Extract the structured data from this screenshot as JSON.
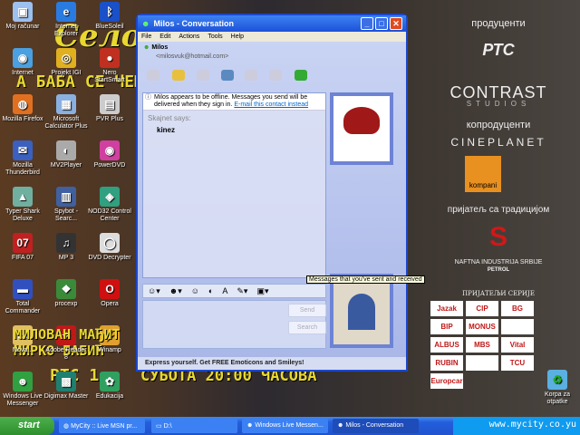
{
  "desktop": {
    "icons": [
      {
        "label": "Moj računar",
        "glyph": "▣",
        "color": "#9cc0f0"
      },
      {
        "label": "Internet Explorer",
        "glyph": "e",
        "color": "#2a7be0"
      },
      {
        "label": "BlueSoleil",
        "glyph": "ᛒ",
        "color": "#1a50c8"
      },
      {
        "label": "Internet",
        "glyph": "◉",
        "color": "#4aa0e0"
      },
      {
        "label": "Projekt IGI",
        "glyph": "◎",
        "color": "#e0b020"
      },
      {
        "label": "Nero StartSmart",
        "glyph": "●",
        "color": "#c03020"
      },
      {
        "label": "Mozilla Firefox",
        "glyph": "◍",
        "color": "#e07020"
      },
      {
        "label": "Microsoft Calculator Plus",
        "glyph": "▦",
        "color": "#8ab0e0"
      },
      {
        "label": "PVR Plus",
        "glyph": "▤",
        "color": "#ccc"
      },
      {
        "label": "Mozilla Thunderbird",
        "glyph": "✉",
        "color": "#3a60c0"
      },
      {
        "label": "MV2Player",
        "glyph": "◐",
        "color": "#aaa"
      },
      {
        "label": "PowerDVD",
        "glyph": "◉",
        "color": "#d040a0"
      },
      {
        "label": "Typer Shark Deluxe",
        "glyph": "▲",
        "color": "#70b0a0"
      },
      {
        "label": "Spybot - Searc...",
        "glyph": "▥",
        "color": "#4060a0"
      },
      {
        "label": "NOD32 Control Center",
        "glyph": "◈",
        "color": "#30a080"
      },
      {
        "label": "FIFA 07",
        "glyph": "07",
        "color": "#c02020"
      },
      {
        "label": "MP 3",
        "glyph": "♫",
        "color": "#333"
      },
      {
        "label": "DVD Decrypter",
        "glyph": "◯",
        "color": "#ddd"
      },
      {
        "label": "Total Commander",
        "glyph": "▬",
        "color": "#3050c0"
      },
      {
        "label": "procexp",
        "glyph": "❖",
        "color": "#3a8a3a"
      },
      {
        "label": "Opera",
        "glyph": "O",
        "color": "#d01010"
      },
      {
        "label": "Nova...",
        "glyph": "▭",
        "color": "#e0c060"
      },
      {
        "label": "Adobe Reader 8",
        "glyph": "✦",
        "color": "#c01818"
      },
      {
        "label": "Winamp",
        "glyph": "⚡",
        "color": "#e0a030"
      },
      {
        "label": "Windows Live Messenger",
        "glyph": "☻",
        "color": "#30a040"
      },
      {
        "label": "Digimax Master",
        "glyph": "▩",
        "color": "#208070"
      },
      {
        "label": "Edukacija",
        "glyph": "✿",
        "color": "#30a060"
      }
    ],
    "recycle_bin": "Korpa za otpatke",
    "wallpaper": {
      "title": "Село гори",
      "subtitle": "А БАБА СЕ ЧЕШЉА",
      "cast1": "МИЛОВАН МАЂИТ",
      "cast2": "МИРКО БАБИЋ",
      "channel": "РТС 1",
      "airtime": "СУБОТА 20:00 ЧАСОВА",
      "producers_label": "продуценти",
      "rts": "РТС",
      "contrast": "CONTRAST",
      "studios": "STUDIOS",
      "coproducers_label": "копродуценти",
      "cineplanet": "CINEPLANET",
      "kompani": "kompani",
      "tradition": "пријатељ са традицијом",
      "nis": "NAFTNA INDUSTRIJA SRBIJE",
      "petrol": "PETROL",
      "friends_label": "ПРИЈАТЕЉИ СЕРИЈЕ",
      "friends": [
        "Jazak",
        "CIP",
        "BG",
        "BIP",
        "MONUS",
        "",
        "ALBUS",
        "MBS",
        "Vital",
        "RUBIN",
        "",
        "TCU",
        "Europcar"
      ]
    }
  },
  "window": {
    "title": "Milos - Conversation",
    "menu": [
      "File",
      "Edit",
      "Actions",
      "Tools",
      "Help"
    ],
    "contact_name": "Milos",
    "contact_email": "<milosvuk@hotmail.com>",
    "toolbar_icons": [
      "invite-icon",
      "send-files-icon",
      "webcam-icon",
      "call-icon",
      "activities-icon",
      "games-icon",
      "block-icon"
    ],
    "info_text": "Milos appears to be offline. Messages you send will be delivered when they sign in.",
    "info_link": "E-mail this contact instead",
    "sender": "Skajnet says:",
    "message": "kinez",
    "send_label": "Send",
    "search_label": "Search",
    "status_text": "Express yourself.  Get FREE Emoticons and Smileys!",
    "tooltip": "Messages that you've sent and received"
  },
  "taskbar": {
    "start": "start",
    "tasks": [
      "MyCity :: Live MSN pr...",
      "D:\\",
      "Windows Live Messen...",
      "Milos - Conversation"
    ],
    "watermark": "www.mycity.co.yu"
  }
}
